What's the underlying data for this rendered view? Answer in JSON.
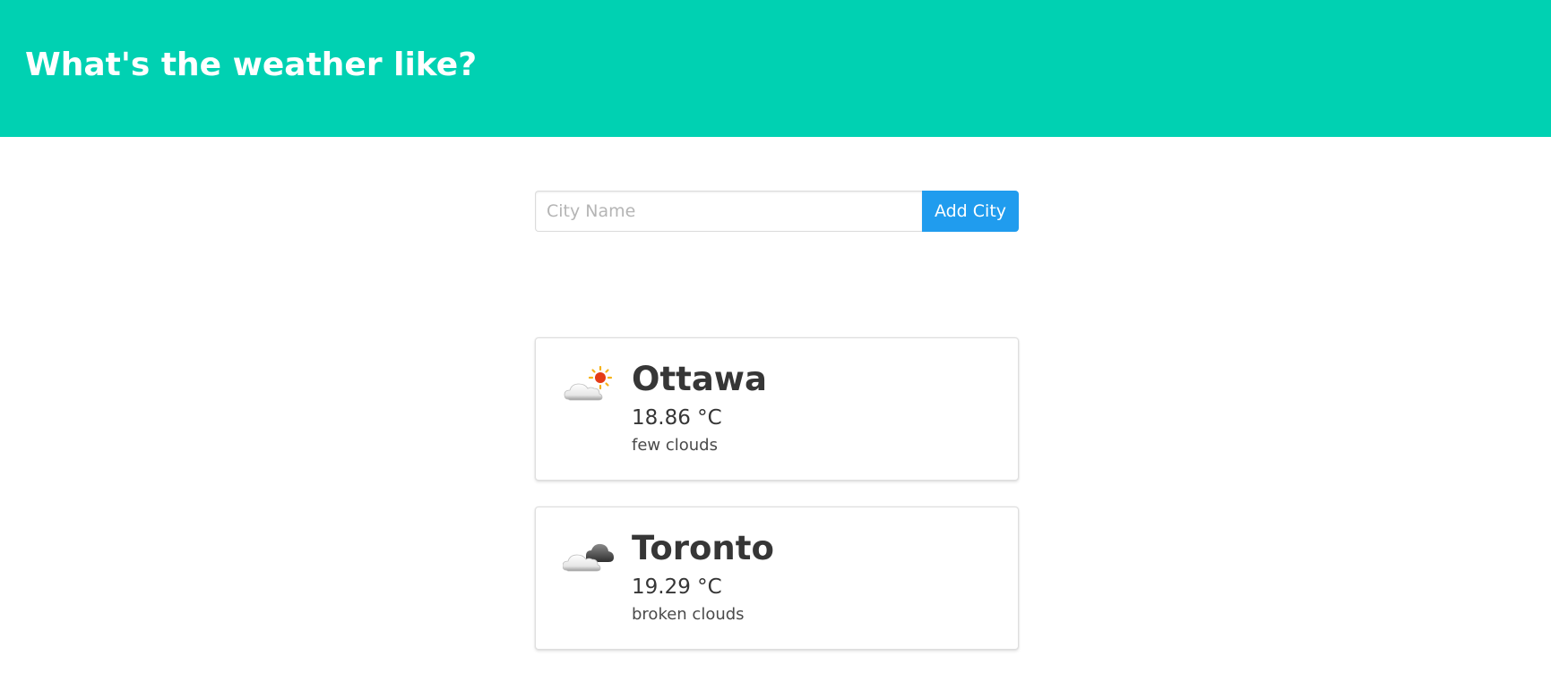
{
  "header": {
    "title": "What's the weather like?",
    "background_color": "#00d1b2"
  },
  "form": {
    "city_placeholder": "City Name",
    "city_value": "",
    "add_button_label": "Add City",
    "button_color": "#209cee"
  },
  "cities": [
    {
      "name": "Ottawa",
      "temperature": "18.86 °C",
      "description": "few clouds",
      "icon": "few-clouds-icon"
    },
    {
      "name": "Toronto",
      "temperature": "19.29 °C",
      "description": "broken clouds",
      "icon": "broken-clouds-icon"
    }
  ]
}
